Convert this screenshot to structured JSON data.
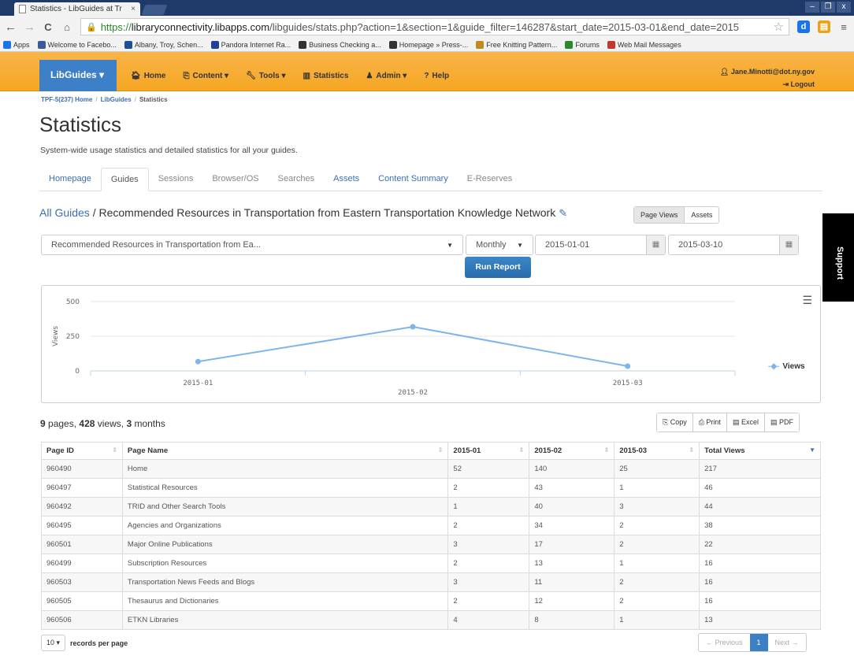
{
  "browser": {
    "tab_title": "Statistics - LibGuides at Tr",
    "tab_close": "×",
    "window_controls": [
      "–",
      "❐",
      "x"
    ],
    "url_scheme": "https://",
    "url_host": "libraryconnectivity.libapps.com",
    "url_path": "/libguides/stats.php?action=1&section=1&guide_filter=146287&start_date=2015-03-01&end_date=2015",
    "bookmarks": [
      {
        "label": "Apps",
        "icon": "apps-icon",
        "color": "#1a73e8"
      },
      {
        "label": "Welcome to Facebo...",
        "icon": "facebook-icon",
        "color": "#3b5998"
      },
      {
        "label": "Albany, Troy, Schen...",
        "icon": "tu-icon",
        "color": "#1d4e9a"
      },
      {
        "label": "Pandora Internet Ra...",
        "icon": "pandora-icon",
        "color": "#224099"
      },
      {
        "label": "Business Checking a...",
        "icon": "bank-icon",
        "color": "#333333"
      },
      {
        "label": "Homepage » Press-...",
        "icon": "pf-icon",
        "color": "#333333"
      },
      {
        "label": "Free Knitting Pattern...",
        "icon": "knit-icon",
        "color": "#c08a1e"
      },
      {
        "label": "Forums",
        "icon": "forum-icon",
        "color": "#2a8a2a"
      },
      {
        "label": "Web Mail Messages",
        "icon": "mail-icon",
        "color": "#c0392b"
      }
    ]
  },
  "nav": {
    "brand": "LibGuides ▾",
    "items": [
      "Home",
      "Content ▾",
      "Tools ▾",
      "Statistics",
      "Admin ▾",
      "Help"
    ],
    "user": "Jane.Minotti@dot.ny.gov",
    "logout": "Logout"
  },
  "breadcrumb": [
    "TPF-5(237) Home",
    "LibGuides",
    "Statistics"
  ],
  "page": {
    "title": "Statistics",
    "subtitle": "System-wide usage statistics and detailed statistics for all your guides."
  },
  "tabs": [
    "Homepage",
    "Guides",
    "Sessions",
    "Browser/OS",
    "Searches",
    "Assets",
    "Content Summary",
    "E-Reserves"
  ],
  "guide": {
    "all_link": "All Guides",
    "name": " / Recommended Resources in Transportation from Eastern Transportation Knowledge Network",
    "view_toggle": [
      "Page Views",
      "Assets"
    ]
  },
  "filters": {
    "guide_select": "Recommended Resources in Transportation from Ea...",
    "period_select": "Monthly",
    "start_date": "2015-01-01",
    "end_date": "2015-03-10",
    "run_button": "Run Report"
  },
  "chart_data": {
    "type": "line",
    "categories": [
      "2015-01",
      "2015-02",
      "2015-03"
    ],
    "series": [
      {
        "name": "Views",
        "values": [
          67,
          318,
          34
        ],
        "color": "#7cb5ec"
      }
    ],
    "ylabel": "Views",
    "yticks": [
      "0",
      "250",
      "500"
    ],
    "ylim": [
      0,
      500
    ],
    "legend": "right",
    "grid": true
  },
  "support": "Support",
  "summary": {
    "pages": "9",
    "pages_label": " pages, ",
    "views": "428",
    "views_label": " views, ",
    "months": "3",
    "months_label": " months"
  },
  "export_buttons": [
    "Copy",
    "Print",
    "Excel",
    "PDF"
  ],
  "table": {
    "headers": [
      "Page ID",
      "Page Name",
      "2015-01",
      "2015-02",
      "2015-03",
      "Total Views"
    ],
    "rows": [
      [
        "960490",
        "Home",
        "52",
        "140",
        "25",
        "217"
      ],
      [
        "960497",
        "Statistical Resources",
        "2",
        "43",
        "1",
        "46"
      ],
      [
        "960492",
        "TRID and Other Search Tools",
        "1",
        "40",
        "3",
        "44"
      ],
      [
        "960495",
        "Agencies and Organizations",
        "2",
        "34",
        "2",
        "38"
      ],
      [
        "960501",
        "Major Online Publications",
        "3",
        "17",
        "2",
        "22"
      ],
      [
        "960499",
        "Subscription Resources",
        "2",
        "13",
        "1",
        "16"
      ],
      [
        "960503",
        "Transportation News Feeds and Blogs",
        "3",
        "11",
        "2",
        "16"
      ],
      [
        "960505",
        "Thesaurus and Dictionaries",
        "2",
        "12",
        "2",
        "16"
      ],
      [
        "960506",
        "ETKN Libraries",
        "4",
        "8",
        "1",
        "13"
      ]
    ]
  },
  "pagination": {
    "per_page_value": "10",
    "per_page_label": "records per page",
    "previous": "← Previous",
    "current": "1",
    "next": "Next →"
  }
}
